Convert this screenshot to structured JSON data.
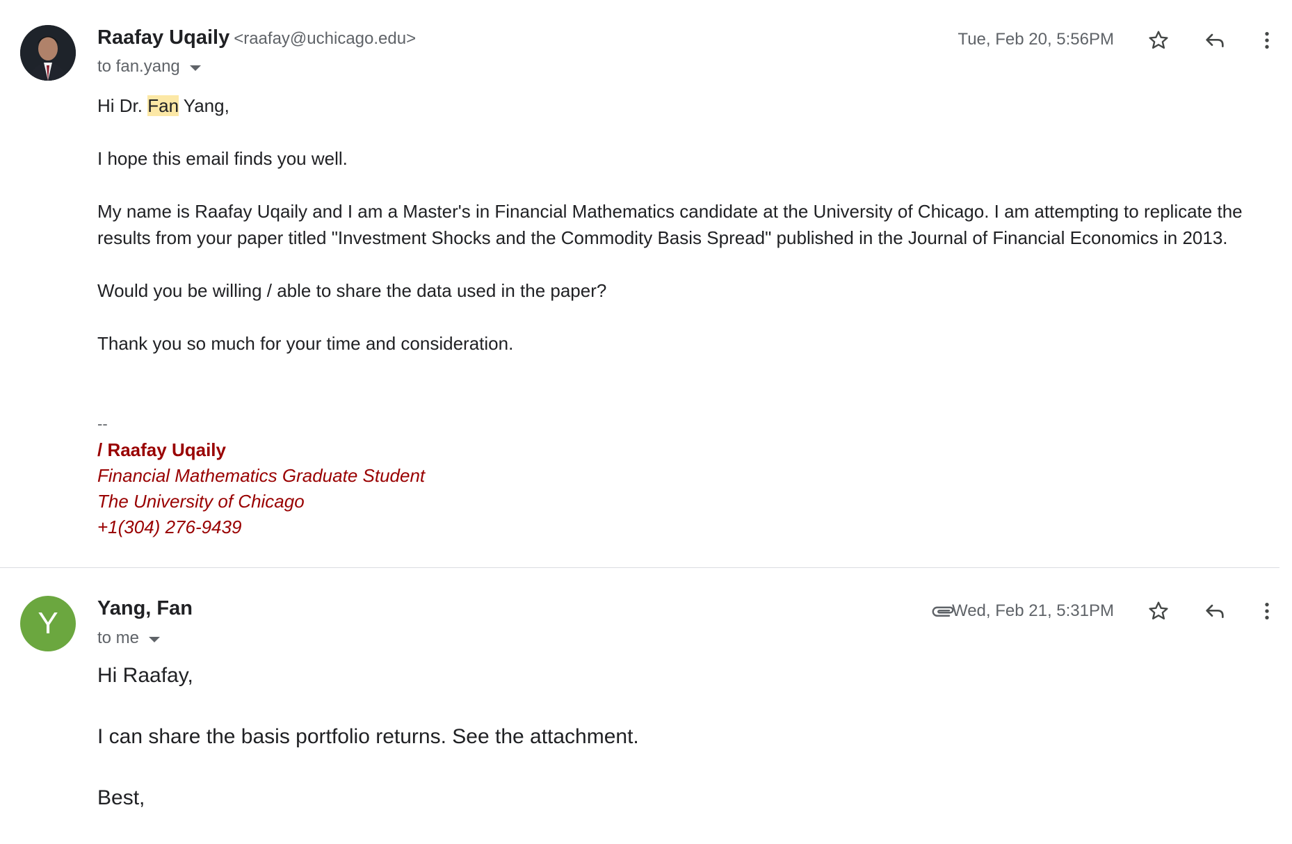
{
  "messages": [
    {
      "sender_name": "Raafay Uqaily",
      "sender_email": "<raafay@uchicago.edu>",
      "to": "to fan.yang",
      "date": "Tue, Feb 20, 5:56PM",
      "greeting_pre": "Hi Dr. ",
      "greeting_highlight": "Fan",
      "greeting_post": " Yang,",
      "paragraphs": [
        "I hope this email finds you well.",
        "My name is Raafay Uqaily and I am a Master's in Financial Mathematics candidate at the University of Chicago. I am attempting to replicate the results from your paper titled \"Investment Shocks and the Commodity Basis Spread\" published in the Journal of Financial Economics in 2013.",
        "Would you be willing / able to share the data used in the paper?",
        "Thank you so much for your time and consideration."
      ],
      "signature": {
        "dash": "--",
        "name": "/ Raafay Uqaily",
        "title": "Financial Mathematics Graduate Student",
        "school": "The University of Chicago",
        "phone": "+1(304) 276-9439"
      }
    },
    {
      "sender_name": "Yang, Fan",
      "avatar_letter": "Y",
      "to": "to me",
      "date": "Wed, Feb 21, 5:31PM",
      "paragraphs": [
        "Hi Raafay,",
        "I can share the basis portfolio returns. See the attachment.",
        "Best,"
      ]
    }
  ],
  "icons": [
    "star-icon",
    "reply-icon",
    "more-vert-icon",
    "paperclip-icon"
  ],
  "colors": {
    "signature": "#990000",
    "highlight": "#fce8a6",
    "avatar_y": "#6ba73f"
  }
}
